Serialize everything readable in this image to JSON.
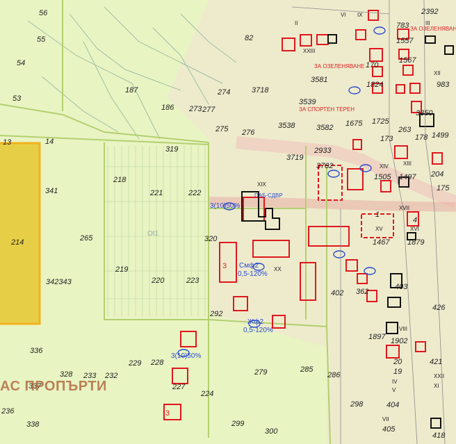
{
  "parcels_left": [
    "56",
    "55",
    "54",
    "53",
    "13",
    "14",
    "341",
    "214",
    "265",
    "342343",
    "336",
    "328",
    "233",
    "232",
    "337",
    "236",
    "338"
  ],
  "parcels_center": [
    "187",
    "186",
    "274",
    "273",
    "277",
    "275",
    "276",
    "82",
    "319",
    "218",
    "221",
    "222",
    "219",
    "220",
    "223",
    "320",
    "292",
    "229",
    "228",
    "227",
    "224",
    "279",
    "285",
    "299",
    "300",
    "286",
    "298"
  ],
  "parcels_right": [
    "3718",
    "3581",
    "3539",
    "3538",
    "3582",
    "3719",
    "2933",
    "3782",
    "1675",
    "1725",
    "173",
    "1824",
    "170",
    "1567",
    "1557",
    "1505",
    "1497",
    "1467",
    "1879",
    "402",
    "403",
    "362",
    "426",
    "1897",
    "1902",
    "20",
    "19",
    "404",
    "405",
    "418",
    "421",
    "263",
    "1499",
    "178",
    "3350",
    "204",
    "175",
    "983",
    "2392",
    "783",
    "1",
    "4"
  ],
  "map_texts": {
    "ot1": "Ot1",
    "sdvr": "ПАБ-СДВР",
    "zone_green_1": "ЗА ОЗЕЛЕНЯВАНЕ",
    "zone_green_2": "ЗА ОЗЕЛЕНЯВАНЕ",
    "sport_field": "ЗА СПОРТЕН ТЕРЕН",
    "storeys_3": "3",
    "coverage_1": "3(10)50%",
    "coverage_2": "Смф2",
    "coverage_3": "Жф2",
    "percent": "0,5-120%",
    "watermark": "АС ПРОПЪРТИ"
  },
  "roman": [
    "XIX",
    "XX",
    "XIV",
    "XIII",
    "XV",
    "XVI",
    "XXIII",
    "XII",
    "XXII",
    "XI",
    "IX",
    "VI",
    "V",
    "IV",
    "III",
    "II",
    "VII",
    "VIII",
    "XVII"
  ],
  "colors": {
    "background": "#e9f4c3",
    "highlight_fill": "#e6cf46",
    "highlight_border": "#f2b21c",
    "building_red": "#e0171d",
    "building_black": "#111111",
    "blue_text": "#2a4bd0",
    "road_pink": "#efd2c8",
    "road_gray": "#8a8a8a"
  }
}
